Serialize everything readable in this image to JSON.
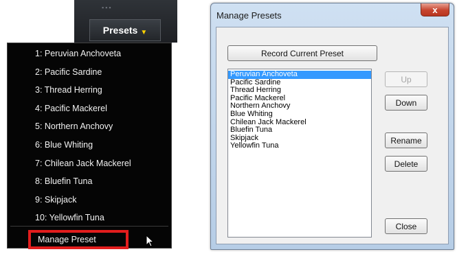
{
  "presets_menu": {
    "button_label": "Presets",
    "items": [
      "1: Peruvian Anchoveta",
      "2: Pacific Sardine",
      "3: Thread Herring",
      "4: Pacific Mackerel",
      "5: Northern Anchovy",
      "6: Blue Whiting",
      "7: Chilean Jack Mackerel",
      "8: Bluefin Tuna",
      "9: Skipjack",
      "10: Yellowfin Tuna"
    ],
    "manage_label": "Manage Preset",
    "highlight_color": "#e21d1d"
  },
  "dialog": {
    "title": "Manage Presets",
    "close_glyph": "x",
    "record_label": "Record Current Preset",
    "up_label": "Up",
    "down_label": "Down",
    "rename_label": "Rename",
    "delete_label": "Delete",
    "close_label": "Close",
    "list": [
      "Peruvian Anchoveta",
      "Pacific Sardine",
      "Thread Herring",
      "Pacific Mackerel",
      "Northern Anchovy",
      "Blue Whiting",
      "Chilean Jack Mackerel",
      "Bluefin Tuna",
      "Skipjack",
      "Yellowfin Tuna"
    ],
    "selected_item": "Peruvian Anchoveta"
  }
}
